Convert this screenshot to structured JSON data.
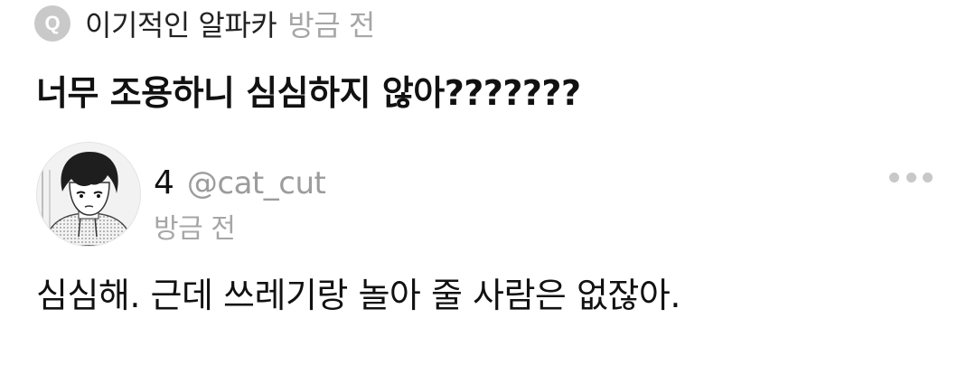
{
  "question": {
    "badge_letter": "Q",
    "asker_name": "이기적인 알파카",
    "time": "방금 전",
    "text": "너무 조용하니 심심하지 않아???????"
  },
  "answer": {
    "answerer_name": "4",
    "handle": "@cat_cut",
    "time": "방금 전",
    "text": "심심해. 근데 쓰레기랑 놀아 줄 사람은 없잖아.",
    "avatar_icon": "avatar-image",
    "more_icon": "more-dots-icon"
  },
  "colors": {
    "primary_text": "#111111",
    "secondary_text": "#a6a6a6",
    "badge_bg": "#c9c9c9"
  }
}
